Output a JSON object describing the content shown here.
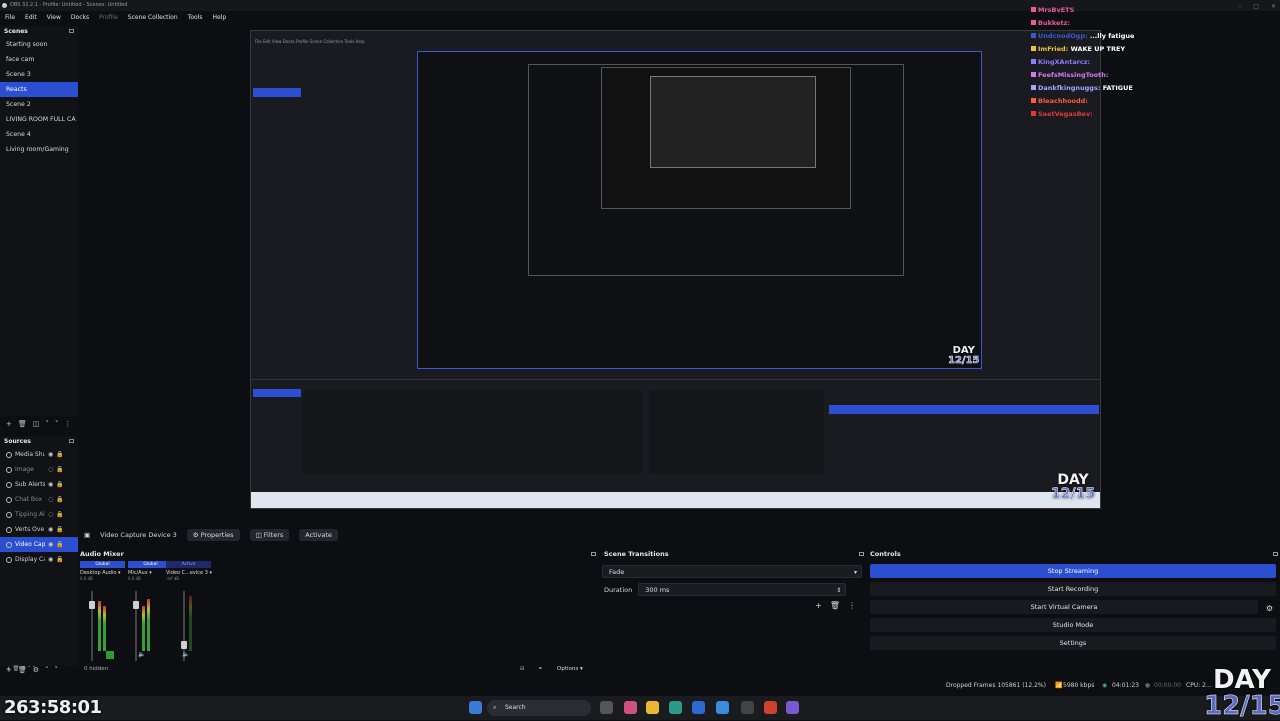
{
  "window": {
    "title": "OBS 32.2.1 - Profile: Untitled - Scenes: Untitled"
  },
  "menu": [
    "File",
    "Edit",
    "View",
    "Docks",
    "Profile",
    "Scene Collection",
    "Tools",
    "Help"
  ],
  "scenes": {
    "title": "Scenes",
    "items": [
      "Starting soon",
      "face cam",
      "Scene 3",
      "Reacts",
      "Scene 2",
      "LIVING ROOM FULL CA",
      "Scene 4",
      "Living room/Gaming"
    ],
    "active_index": 3
  },
  "sources": {
    "title": "Sources",
    "items": [
      "Media Shu",
      "Image",
      "Sub Alerts",
      "Chat Box",
      "Tipping Al",
      "Verts Ove",
      "Video Cap",
      "Display Ca"
    ],
    "active_index": 6
  },
  "source_bar": {
    "selected": "Video Capture Device 3",
    "properties": "Properties",
    "filters": "Filters",
    "activate": "Activate"
  },
  "audio_mixer": {
    "title": "Audio Mixer",
    "channels": [
      {
        "tag": "Global",
        "name": "Desktop Audio",
        "db": "0.0 dB"
      },
      {
        "tag": "Global",
        "name": "Mic/Aux",
        "db": "0.0 dB"
      },
      {
        "tag": "Active",
        "name": "Video C...evice 3",
        "db": "-inf dB"
      }
    ],
    "hidden": "0 hidden",
    "options": "Options"
  },
  "transitions": {
    "title": "Scene Transitions",
    "selected": "Fade",
    "duration_label": "Duration",
    "duration_value": "300 ms"
  },
  "controls": {
    "title": "Controls",
    "buttons": [
      "Stop Streaming",
      "Start Recording",
      "Start Virtual Camera",
      "Studio Mode",
      "Settings"
    ]
  },
  "status": {
    "dropped": "Dropped Frames 105861 (12.2%)",
    "bitrate": "5980 kbps",
    "live_time": "04:01:23",
    "rec_time": "00:00:00",
    "cpu": "CPU: 2..."
  },
  "taskbar": {
    "search": "Search"
  },
  "overlay": {
    "timer": "263:58:01",
    "day": "DAY",
    "day_count": "12/15"
  },
  "chat": [
    {
      "user": "MrsBvETS",
      "color": "#e85a9a",
      "msg": ""
    },
    {
      "user": "Bukketz:",
      "color": "#e85a9a",
      "msg": ""
    },
    {
      "user": "UndcnodOgp:",
      "color": "#3a5acc",
      "msg": "...lly fatigue"
    },
    {
      "user": "ImFried:",
      "color": "#f0c040",
      "msg": "WAKE UP TREY"
    },
    {
      "user": "KingXAntarcz:",
      "color": "#8a7bff",
      "msg": ""
    },
    {
      "user": "FeefsMissingTooth:",
      "color": "#d07af0",
      "msg": ""
    },
    {
      "user": "Dankfkingnuggs:",
      "color": "#a0a8ff",
      "msg": "FATIGUE"
    },
    {
      "user": "Bleachhoodd:",
      "color": "#ff5a3a",
      "msg": ""
    },
    {
      "user": "SaetVegasBev:",
      "color": "#e03a3a",
      "msg": ""
    }
  ]
}
